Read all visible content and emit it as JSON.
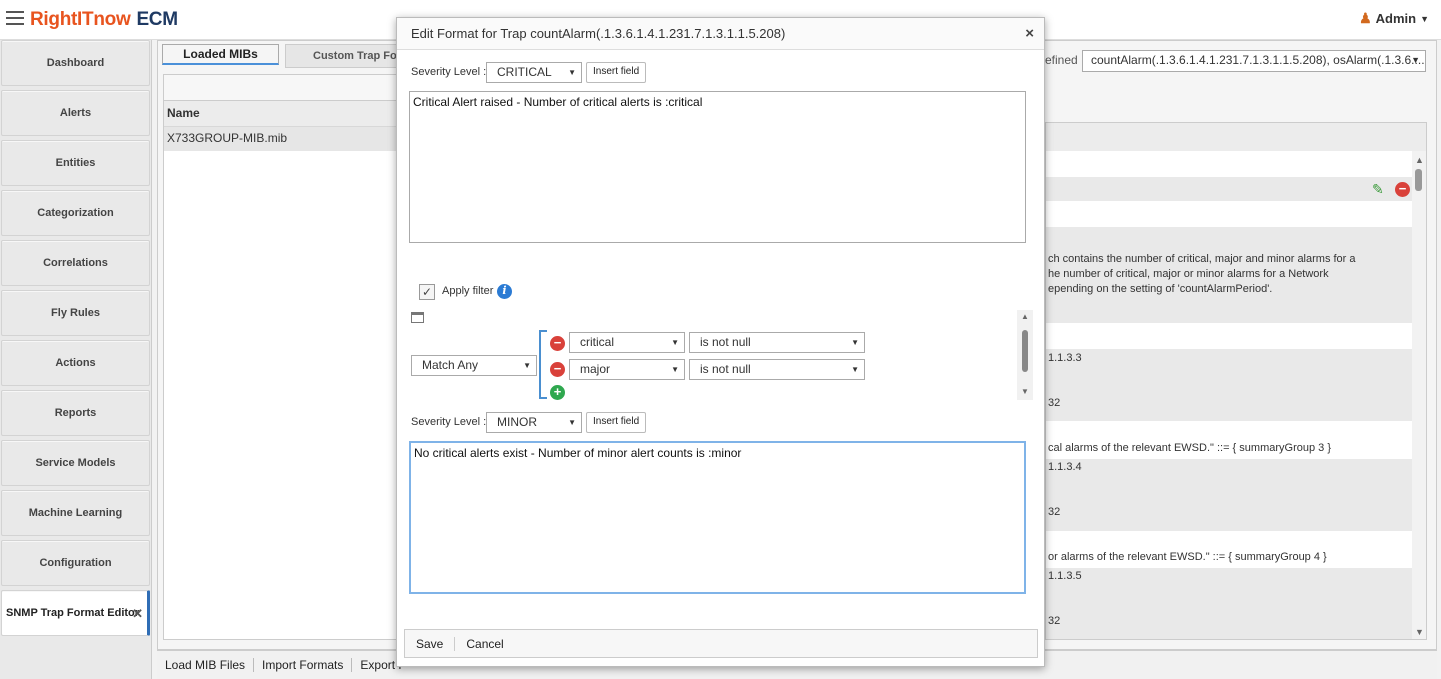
{
  "app": {
    "logo_part1": "Right",
    "logo_part2": "IT",
    "logo_part3": "now",
    "logo_part4": "ECM",
    "user": "Admin"
  },
  "sidebar": {
    "items": [
      {
        "label": "Dashboard"
      },
      {
        "label": "Alerts"
      },
      {
        "label": "Entities"
      },
      {
        "label": "Categorization"
      },
      {
        "label": "Correlations"
      },
      {
        "label": "Fly Rules"
      },
      {
        "label": "Actions"
      },
      {
        "label": "Reports"
      },
      {
        "label": "Service Models"
      },
      {
        "label": "Machine Learning"
      },
      {
        "label": "Configuration"
      },
      {
        "label": "SNMP Trap Format Editor",
        "close": "✕"
      }
    ]
  },
  "tabs": {
    "loaded": "Loaded MIBs",
    "custom": "Custom Trap Form"
  },
  "left_grid": {
    "col_name": "Name",
    "rows": [
      "X733GROUP-MIB.mib"
    ]
  },
  "bottom": {
    "load": "Load MIB Files",
    "import": "Import Formats",
    "export": "Export F"
  },
  "right": {
    "defined_label": "efined",
    "trap_select": "countAlarm(.1.3.6.1.4.1.231.7.1.3.1.1.5.208), osAlarm(.1.3.6....",
    "lines": [
      "ch contains the number of critical, major and minor alarms for a",
      "he number of critical, major or minor alarms for a Network",
      "epending on the setting of 'countAlarmPeriod'.",
      "1.1.3.3",
      "32",
      "cal alarms of the relevant EWSD.\" ::= { summaryGroup 3 }",
      "1.1.3.4",
      "32",
      "or alarms of the relevant EWSD.\" ::= { summaryGroup 4 }",
      "1.1.3.5",
      "32"
    ]
  },
  "modal": {
    "title": "Edit Format for Trap countAlarm(.1.3.6.1.4.1.231.7.1.3.1.1.5.208)",
    "close": "×",
    "severity_label": "Severity Level :",
    "insert_field": "Insert field",
    "block1": {
      "severity": "CRITICAL",
      "text": "Critical Alert raised - Number of critical alerts is :critical"
    },
    "apply_filter": "Apply filter",
    "filter": {
      "match": "Match Any",
      "rules": [
        {
          "field": "critical",
          "op": "is not null"
        },
        {
          "field": "major",
          "op": "is not null"
        }
      ]
    },
    "block2": {
      "severity": "MINOR",
      "text": "No critical alerts exist - Number of minor alert counts is :minor"
    },
    "save": "Save",
    "cancel": "Cancel"
  },
  "colors": {
    "accent": "#2f6db5",
    "logo_orange": "#e8541f",
    "logo_navy": "#1f3a63",
    "remove": "#d9413a",
    "add": "#2fa84f"
  }
}
